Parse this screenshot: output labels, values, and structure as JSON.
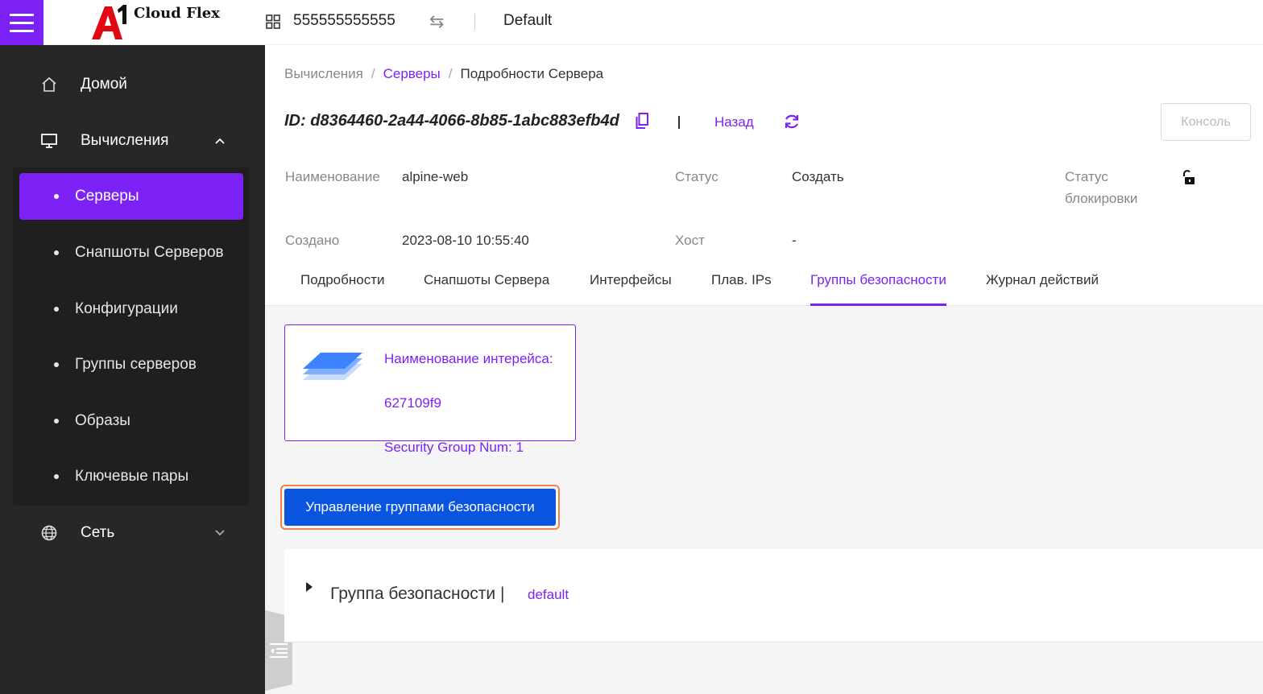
{
  "topbar": {
    "logo_text": "Cloud Flex",
    "project_id": "555555555555",
    "region": "Default"
  },
  "sidebar": {
    "home": "Домой",
    "compute": "Вычисления",
    "compute_items": [
      {
        "label": "Серверы",
        "active": true
      },
      {
        "label": "Снапшоты Серверов"
      },
      {
        "label": "Конфигурации"
      },
      {
        "label": "Группы серверов"
      },
      {
        "label": "Образы"
      },
      {
        "label": "Ключевые пары"
      }
    ],
    "network": "Сеть"
  },
  "breadcrumb": {
    "root": "Вычисления",
    "servers": "Серверы",
    "current": "Подробности Сервера",
    "separator": "/"
  },
  "server": {
    "id_text": "ID:  d8364460-2a44-4066-8b85-1abc883efb4d",
    "back": "Назад",
    "console": "Консоль"
  },
  "details": {
    "name_label": "Наименование",
    "name_value": "alpine-web",
    "status_label": "Статус",
    "status_value": "Создать",
    "lock_label_1": "Статус",
    "lock_label_2": "блокировки",
    "created_label": "Создано",
    "created_value": "2023-08-10 10:55:40",
    "host_label": "Хост",
    "host_value": "-"
  },
  "tabs": [
    "Подробности",
    "Снапшоты Сервера",
    "Интерфейсы",
    "Плав. IPs",
    "Группы безопасности",
    "Журнал действий"
  ],
  "active_tab": "Группы безопасности",
  "interface_card": {
    "title": "Наименование интерейса:",
    "name": "627109f9",
    "sg_num": "Security Group Num: 1"
  },
  "manage_button": "Управление группами безопасности",
  "security_group": {
    "label": "Группа безопасности |",
    "value": "default"
  },
  "colors": {
    "accent": "#7c22f6",
    "primary_button": "#0a55e0",
    "sidebar_bg": "#272727",
    "focus_outline": "#f0824a",
    "logo_red": "#e30613"
  }
}
